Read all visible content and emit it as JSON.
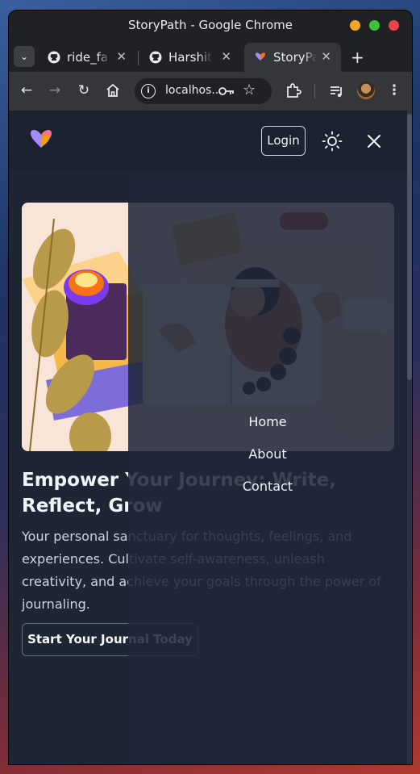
{
  "window": {
    "title": "StoryPath - Google Chrome",
    "controls": [
      "minimize",
      "maximize",
      "close"
    ]
  },
  "tabs": [
    {
      "label": "ride_fa",
      "icon": "github-icon"
    },
    {
      "label": "Harshit",
      "icon": "github-icon"
    },
    {
      "label": "StoryPa",
      "icon": "storypath-favicon",
      "active": true
    }
  ],
  "toolbar": {
    "url": "localhos..."
  },
  "navbar": {
    "login_label": "Login"
  },
  "hero": {
    "title": "Empower Your Journey: Write, Reflect, Grow",
    "description": "Your personal sanctuary for thoughts, feelings, and experiences. Cultivate self-awareness, unleash creativity, and achieve your goals through the power of journaling.",
    "cta_label": "Start Your Journal Today"
  },
  "menu": {
    "items": [
      "Home",
      "About",
      "Contact"
    ]
  },
  "colors": {
    "page_bg": "#1e2635",
    "navbar_bg": "#1b2230",
    "text": "#f1f5f9"
  }
}
